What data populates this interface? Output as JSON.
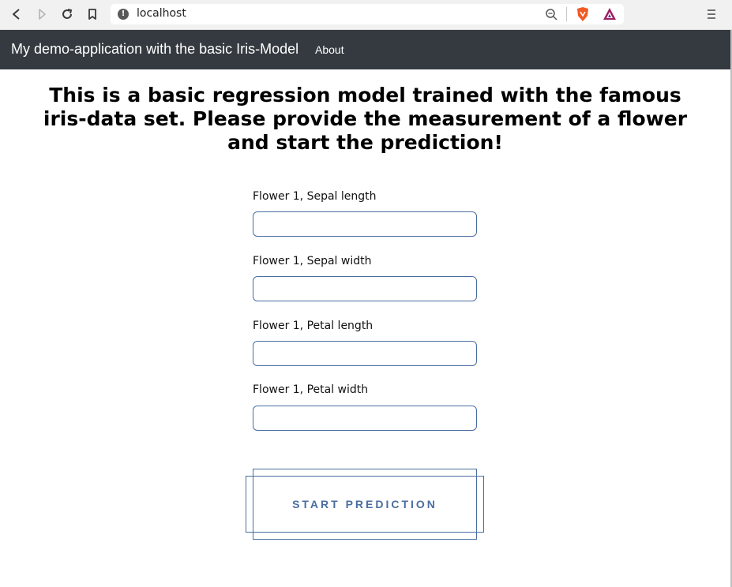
{
  "browser": {
    "url": "localhost",
    "icons": [
      "back-icon",
      "forward-icon",
      "reload-icon",
      "bookmark-icon",
      "site-info-icon",
      "zoom-icon",
      "brave-shield-icon",
      "brave-rewards-icon",
      "menu-icon"
    ]
  },
  "navbar": {
    "brand": "My demo-application with the basic Iris-Model",
    "about": "About",
    "background": "#343a40"
  },
  "main": {
    "heading": "This is a basic regression model trained with the famous iris-data set. Please provide the measurement of a flower and start the prediction!",
    "fields": [
      {
        "label": "Flower 1, Sepal length",
        "value": ""
      },
      {
        "label": "Flower 1, Sepal width",
        "value": ""
      },
      {
        "label": "Flower 1, Petal length",
        "value": ""
      },
      {
        "label": "Flower 1, Petal width",
        "value": ""
      }
    ],
    "submit_label": "START PREDICTION",
    "accent": "#4a6ea0"
  }
}
